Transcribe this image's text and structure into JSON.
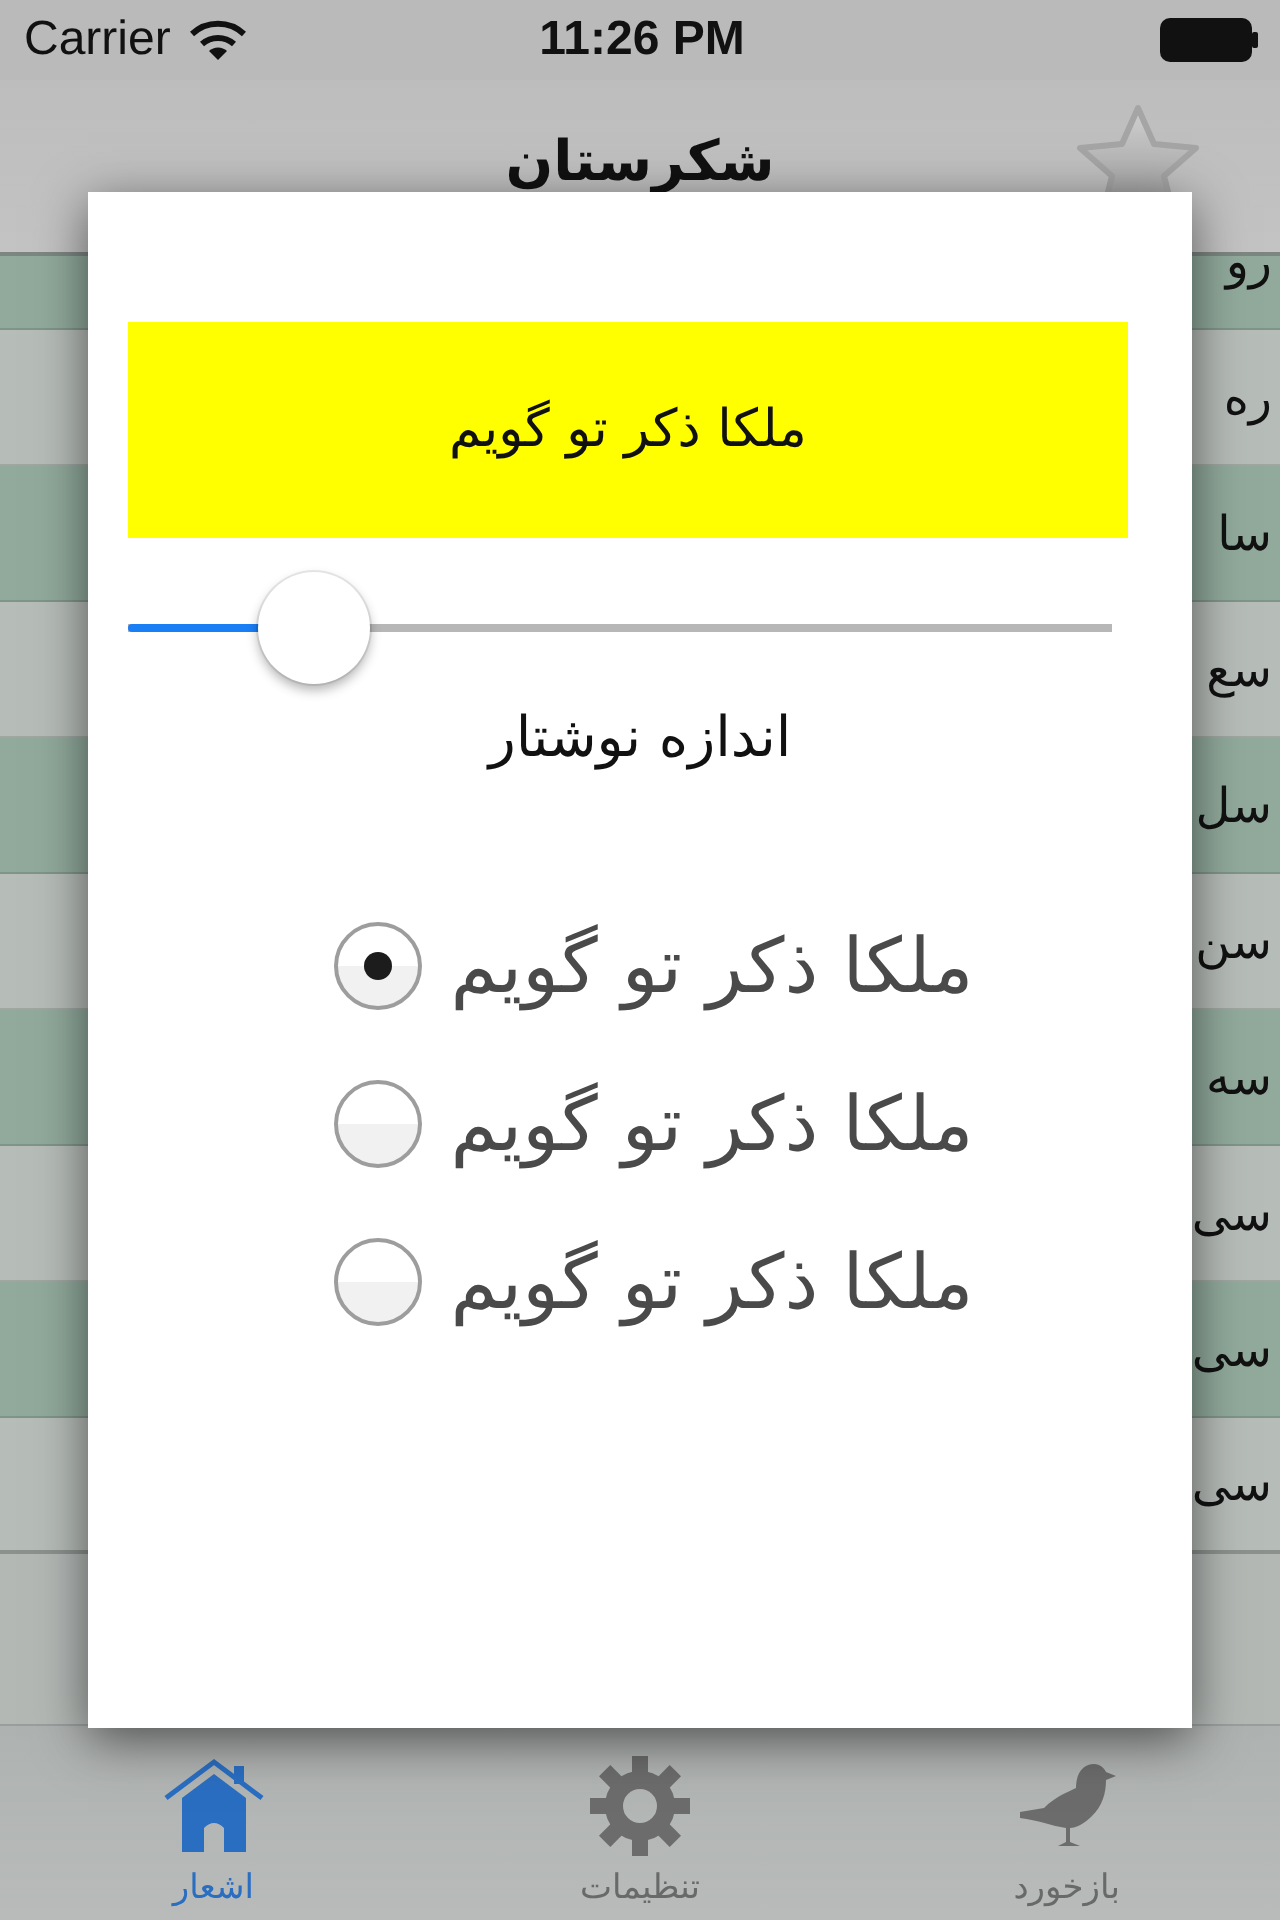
{
  "status_bar": {
    "carrier": "Carrier",
    "time": "11:26 PM"
  },
  "nav_bar": {
    "title": "شکرستان"
  },
  "list": {
    "rows": [
      {
        "text": "رو"
      },
      {
        "text": "ره"
      },
      {
        "text": "سا"
      },
      {
        "text": "سع"
      },
      {
        "text": "سل"
      },
      {
        "text": "سن"
      },
      {
        "text": "سه"
      },
      {
        "text": "سی"
      },
      {
        "text": "سی"
      },
      {
        "text": "سی"
      }
    ]
  },
  "dialog": {
    "preview": "ملکا ذکر تو گویم",
    "font_size_slider": {
      "level": 0.15
    },
    "font_size_label": "اندازه نوشتار",
    "font_options": [
      {
        "label": "ملکا ذکر تو گویم",
        "selected": true
      },
      {
        "label": "ملکا ذکر تو گویم",
        "selected": false
      },
      {
        "label": "ملکا ذکر تو گویم",
        "selected": false
      }
    ]
  },
  "tab_bar": {
    "tabs": [
      {
        "label": "بازخورد",
        "selected": false
      },
      {
        "label": "تنظیمات",
        "selected": false
      },
      {
        "label": "اشعار",
        "selected": true
      }
    ]
  }
}
